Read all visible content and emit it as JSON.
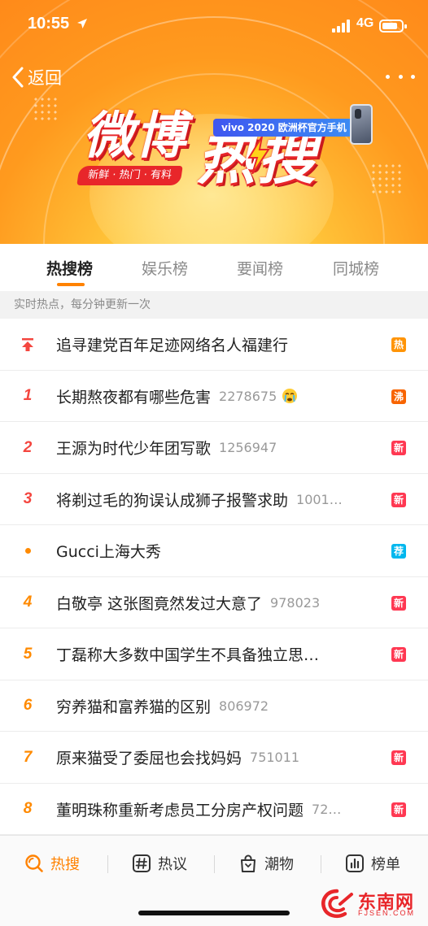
{
  "status_bar": {
    "time": "10:55",
    "network": "4G"
  },
  "nav": {
    "back_label": "返回"
  },
  "banner": {
    "logo_part1": "微博",
    "logo_part2": "热搜",
    "tagline": "新鲜 · 热门 · 有料",
    "sponsor": "vivo 2020 欧洲杯官方手机"
  },
  "tabs": [
    {
      "label": "热搜榜",
      "active": true
    },
    {
      "label": "娱乐榜",
      "active": false
    },
    {
      "label": "要闻榜",
      "active": false
    },
    {
      "label": "同城榜",
      "active": false
    }
  ],
  "notice": "实时热点，每分钟更新一次",
  "items": [
    {
      "rank": "",
      "rank_kind": "pin",
      "title": "追寻建党百年足迹网络名人福建行",
      "count": "",
      "emoji": "",
      "badge": "热",
      "badge_color": "#ff9406"
    },
    {
      "rank": "1",
      "rank_kind": "top3",
      "title": "长期熬夜都有哪些危害",
      "count": "2278675",
      "emoji": "crying-face",
      "badge": "沸",
      "badge_color": "#f86400"
    },
    {
      "rank": "2",
      "rank_kind": "top3",
      "title": "王源为时代少年团写歌",
      "count": "1256947",
      "emoji": "",
      "badge": "新",
      "badge_color": "#ff3852"
    },
    {
      "rank": "3",
      "rank_kind": "top3",
      "title": "将剃过毛的狗误认成狮子报警求助",
      "count": "1001…",
      "emoji": "",
      "badge": "新",
      "badge_color": "#ff3852"
    },
    {
      "rank": "",
      "rank_kind": "dot",
      "title": "Gucci上海大秀",
      "count": "",
      "emoji": "",
      "badge": "荐",
      "badge_color": "#00b7ee"
    },
    {
      "rank": "4",
      "rank_kind": "norm",
      "title": "白敬亭 这张图竟然发过大意了",
      "count": "978023",
      "emoji": "",
      "badge": "新",
      "badge_color": "#ff3852"
    },
    {
      "rank": "5",
      "rank_kind": "norm",
      "title": "丁磊称大多数中国学生不具备独立思…",
      "count": "",
      "emoji": "",
      "badge": "新",
      "badge_color": "#ff3852"
    },
    {
      "rank": "6",
      "rank_kind": "norm",
      "title": "穷养猫和富养猫的区别",
      "count": "806972",
      "emoji": "",
      "badge": "",
      "badge_color": ""
    },
    {
      "rank": "7",
      "rank_kind": "norm",
      "title": "原来猫受了委屈也会找妈妈",
      "count": "751011",
      "emoji": "",
      "badge": "新",
      "badge_color": "#ff3852"
    },
    {
      "rank": "8",
      "rank_kind": "norm",
      "title": "董明珠称重新考虑员工分房产权问题",
      "count": "72…",
      "emoji": "",
      "badge": "新",
      "badge_color": "#ff3852"
    }
  ],
  "bottom_nav": [
    {
      "label": "热搜",
      "icon": "search-icon",
      "active": true
    },
    {
      "label": "热议",
      "icon": "hashtag-icon",
      "active": false
    },
    {
      "label": "潮物",
      "icon": "shopping-bag-icon",
      "active": false
    },
    {
      "label": "榜单",
      "icon": "chart-icon",
      "active": false
    }
  ],
  "watermark": {
    "name": "东南网",
    "url": "FJSEN.COM"
  },
  "colors": {
    "accent": "#ff8200",
    "top3_rank": "#f4463f",
    "normal_rank": "#ff8a00"
  }
}
